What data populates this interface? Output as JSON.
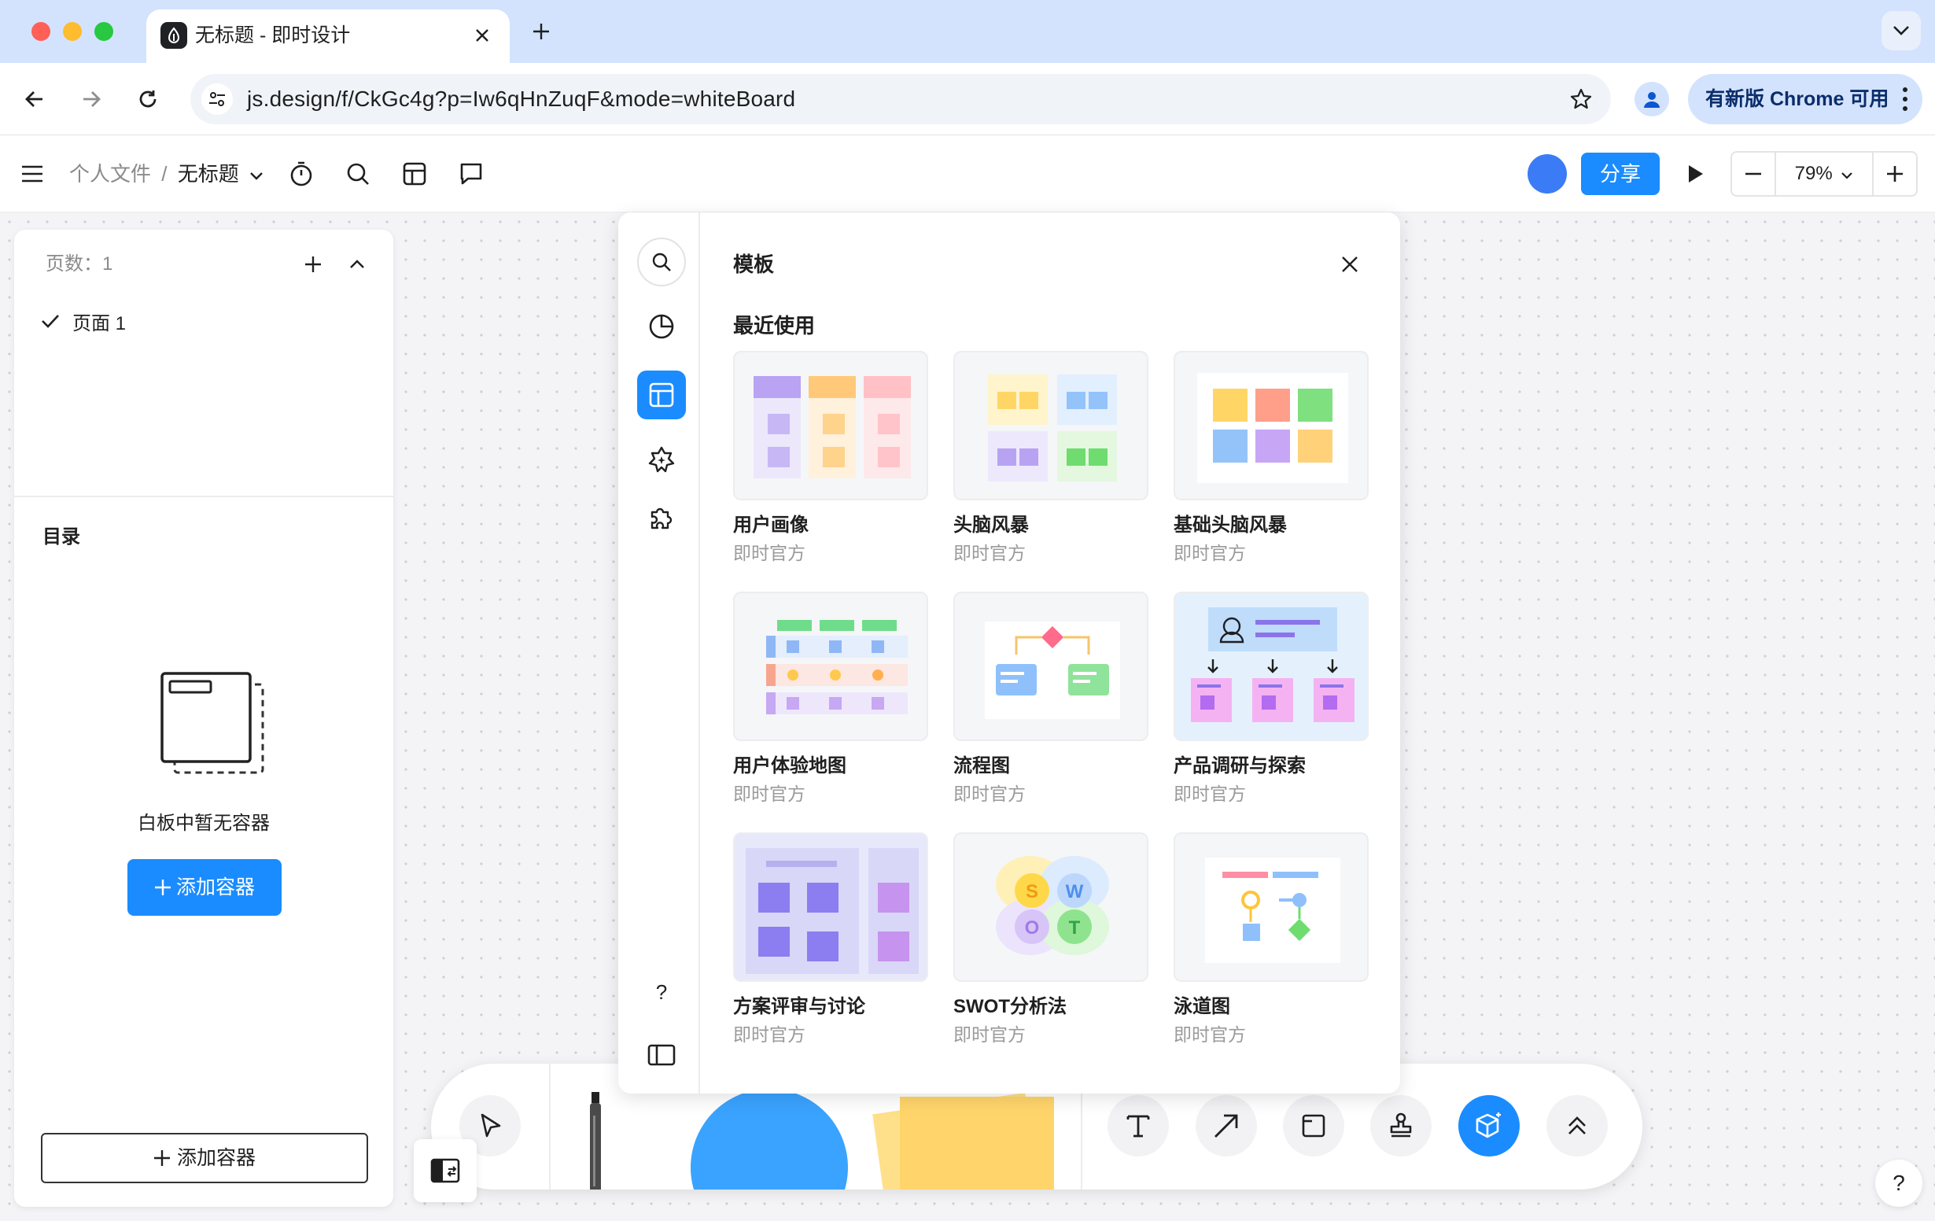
{
  "browser": {
    "tab_title": "无标题 - 即时设计",
    "url": "js.design/f/CkGc4g?p=Iw6qHnZuqF&mode=whiteBoard",
    "update_chip": "有新版 Chrome 可用"
  },
  "header": {
    "breadcrumb_parent": "个人文件",
    "breadcrumb_sep": "/",
    "file_name": "无标题",
    "share_label": "分享",
    "zoom_level": "79%"
  },
  "left_panel": {
    "pages_label": "页数：1",
    "pages": [
      {
        "label": "页面 1",
        "selected": true
      }
    ],
    "toc_title": "目录",
    "empty_text": "白板中暂无容器",
    "add_container_primary": "添加容器",
    "add_container_outline": "添加容器"
  },
  "template_panel": {
    "title": "模板",
    "section": "最近使用",
    "templates": [
      {
        "name": "用户画像",
        "author": "即时官方"
      },
      {
        "name": "头脑风暴",
        "author": "即时官方"
      },
      {
        "name": "基础头脑风暴",
        "author": "即时官方"
      },
      {
        "name": "用户体验地图",
        "author": "即时官方"
      },
      {
        "name": "流程图",
        "author": "即时官方"
      },
      {
        "name": "产品调研与探索",
        "author": "即时官方"
      },
      {
        "name": "方案评审与讨论",
        "author": "即时官方"
      },
      {
        "name": "SWOT分析法",
        "author": "即时官方"
      },
      {
        "name": "泳道图",
        "author": "即时官方"
      }
    ],
    "help_label": "?"
  },
  "help_button": "?",
  "colors": {
    "accent": "#1a8cff",
    "chrome_tabbar": "#d3e3fd",
    "avatar": "#3b7cf6",
    "sticky_yellow": "#ffd56b",
    "shape_blue": "#3aa3ff"
  }
}
